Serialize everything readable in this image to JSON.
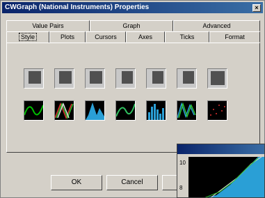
{
  "window": {
    "title": "CWGraph (National Instruments) Properties",
    "close_glyph": "×"
  },
  "tabs_back": [
    "Value Pairs",
    "Graph",
    "Advanced"
  ],
  "tabs_front": [
    "Style",
    "Plots",
    "Cursors",
    "Axes",
    "Ticks",
    "Format"
  ],
  "active_tab": "Style",
  "style_thumbnails": {
    "row1": [
      "style-grid-1",
      "style-grid-2",
      "style-grid-3",
      "style-grid-4",
      "style-grid-5",
      "style-grid-6",
      "style-grid-7"
    ],
    "row2": [
      "style-waveform-green",
      "style-waveform-multicolor",
      "style-area-blue",
      "style-waveform-teal",
      "style-bars-blue",
      "style-waveform-teal-green",
      "style-scatter-red"
    ]
  },
  "buttons": {
    "ok": "OK",
    "cancel": "Cancel"
  },
  "popup": {
    "y_top": "10",
    "y_mid": "8"
  },
  "colors": {
    "title_start": "#0a246a",
    "title_end": "#3a6ea5",
    "face": "#d4d0c8",
    "plot_green": "#00c000",
    "plot_blue": "#2a9fd6"
  }
}
